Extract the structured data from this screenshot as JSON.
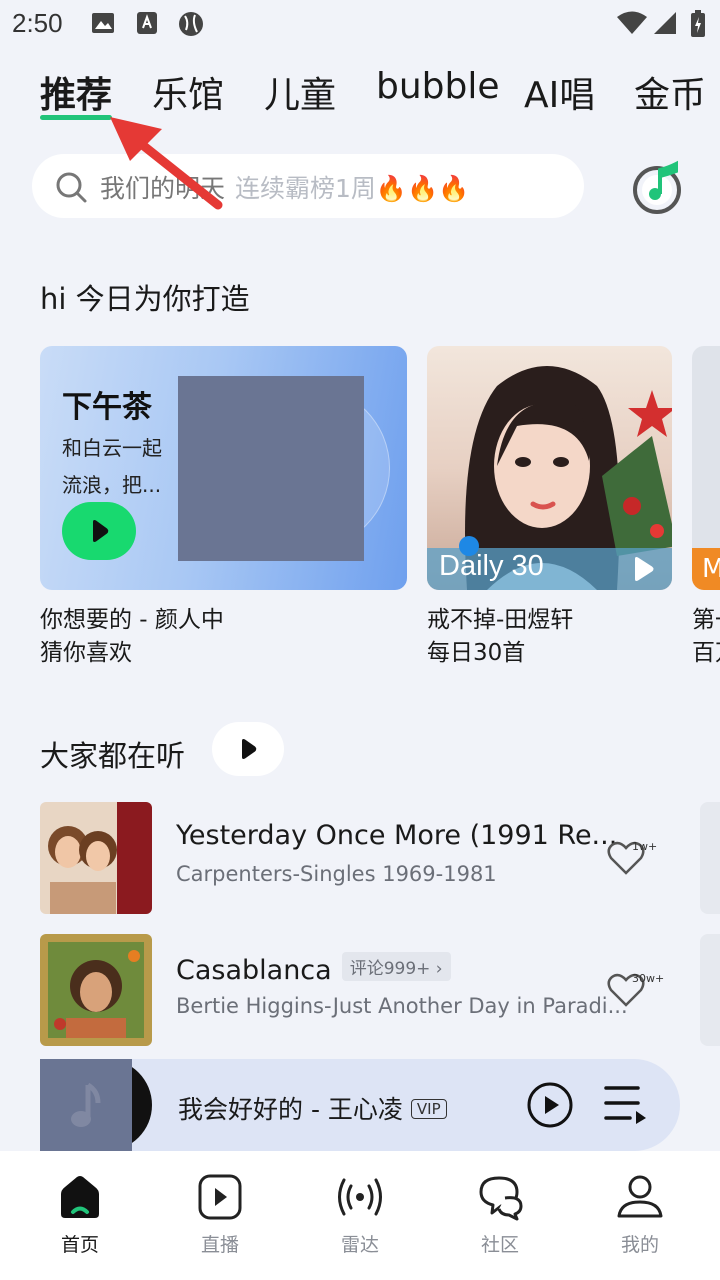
{
  "status_bar": {
    "time": "2:50"
  },
  "top_tabs": [
    {
      "label": "推荐",
      "active": true
    },
    {
      "label": "乐馆",
      "active": false
    },
    {
      "label": "儿童",
      "active": false
    },
    {
      "label": "bubble",
      "active": false
    },
    {
      "label": "AI唱",
      "active": false
    },
    {
      "label": "金币",
      "active": false
    }
  ],
  "search": {
    "query": "我们的明天",
    "hint": "连续霸榜1周🔥🔥🔥"
  },
  "daily_section": {
    "title": "hi 今日为你打造",
    "cards": [
      {
        "title": "下午茶",
        "desc": "和白云一起流浪，把...",
        "caption_line1": "你想要的 - 颜人中",
        "caption_line2": "猜你喜欢"
      },
      {
        "badge": "Daily 30",
        "caption_line1": "戒不掉-田煜轩",
        "caption_line2": "每日30首"
      },
      {
        "tag": "M",
        "caption_line1": "第一",
        "caption_line2": "百万"
      }
    ]
  },
  "listening_section": {
    "title": "大家都在听",
    "songs": [
      {
        "title": "Yesterday Once More (1991 Re...",
        "subtitle": "Carpenters-Singles 1969-1981",
        "likes": "1w+",
        "comment_badge": ""
      },
      {
        "title": "Casablanca",
        "subtitle": "Bertie Higgins-Just Another Day in Paradi...",
        "likes": "30w+",
        "comment_badge": "评论999+"
      }
    ]
  },
  "mini_player": {
    "title": "我会好好的 - 王心凌",
    "vip": "VIP"
  },
  "bottom_nav": [
    {
      "label": "首页",
      "icon": "home-icon",
      "active": true
    },
    {
      "label": "直播",
      "icon": "live-play-icon",
      "active": false
    },
    {
      "label": "雷达",
      "icon": "radar-icon",
      "active": false
    },
    {
      "label": "社区",
      "icon": "community-chat-icon",
      "active": false
    },
    {
      "label": "我的",
      "icon": "profile-icon",
      "active": false
    }
  ],
  "colors": {
    "accent_green": "#21c47a",
    "play_green": "#18d96f",
    "annotation_red": "#e53935"
  }
}
